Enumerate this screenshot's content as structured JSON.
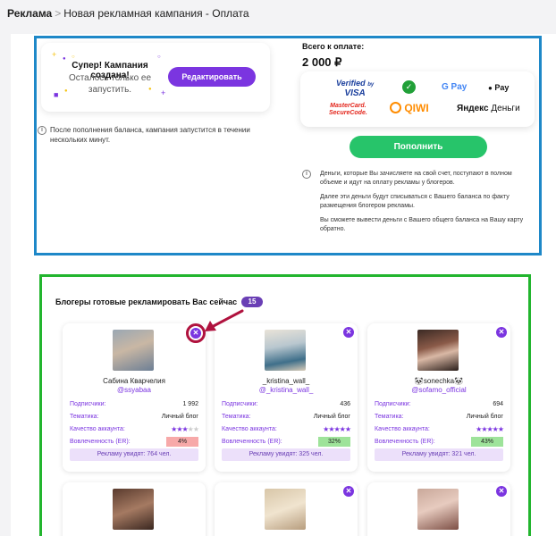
{
  "breadcrumb": {
    "root": "Реклама",
    "separator": ">",
    "current": "Новая рекламная кампания - Оплата"
  },
  "campaign": {
    "title": "Супер! Кампания создана!",
    "subtitle": "Осталось только ее запустить.",
    "edit_label": "Редактировать",
    "note": "После пополнения баланса, кампания запустится в течении нескольких минут."
  },
  "payment": {
    "title": "Всего к оплате:",
    "amount": "2 000 ₽",
    "methods": [
      "Verified by VISA",
      "Sberbank",
      "G Pay",
      "Apple Pay",
      "MasterCard SecureCode",
      "QIWI",
      "Яндекс Деньги"
    ],
    "method_text": {
      "visa_top": "Verified",
      "visa_by": "by",
      "visa_bottom": "VISA",
      "gpay": "G Pay",
      "applepay": "Pay",
      "mc_top": "MasterCard.",
      "mc_bottom": "SecureCode.",
      "qiwi": "QIWI",
      "yandex_bold": "Яндекс",
      "yandex_rest": "Деньги"
    },
    "topup_label": "Пополнить",
    "notes": [
      "Деньги, которые Вы зачисляете на свой счет, поступают в полном объеме и идут на оплату рекламы у блогеров.",
      "Далее эти деньги будут списываться с Вашего баланса по факту размещения блогером рекламы.",
      "Вы сможете вывести деньги с Вашего общего баланса на Вашу карту обратно."
    ]
  },
  "bloggers": {
    "title": "Блогеры готовые рекламировать Вас сейчас",
    "count": "15",
    "labels": {
      "followers": "Подписчики:",
      "topic": "Тематика:",
      "quality": "Качество аккаунта:",
      "er": "Вовлеченность (ER):"
    },
    "close_symbol": "✕",
    "cards": [
      {
        "name": "Сабина Кварчелия",
        "handle": "@ssyabaa",
        "followers": "1 992",
        "topic": "Личный блог",
        "stars": 3,
        "er": "4%",
        "er_level": "bad",
        "reach": "Рекламу увидят: 764 чел."
      },
      {
        "name": "_kristina_wall_",
        "handle": "@_kristina_wall_",
        "followers": "436",
        "topic": "Личный блог",
        "stars": 5,
        "er": "32%",
        "er_level": "good",
        "reach": "Рекламу увидят: 325 чел."
      },
      {
        "name": "🐼sonechka🐼",
        "handle": "@sofamo_official",
        "followers": "694",
        "topic": "Личный блог",
        "stars": 5,
        "er": "43%",
        "er_level": "good",
        "reach": "Рекламу увидят: 321 чел."
      }
    ]
  },
  "colors": {
    "accent": "#7b35e0",
    "success": "#27c46a",
    "frame_blue": "#1e88c8",
    "frame_green": "#22b52e",
    "highlight": "#b0123e"
  }
}
